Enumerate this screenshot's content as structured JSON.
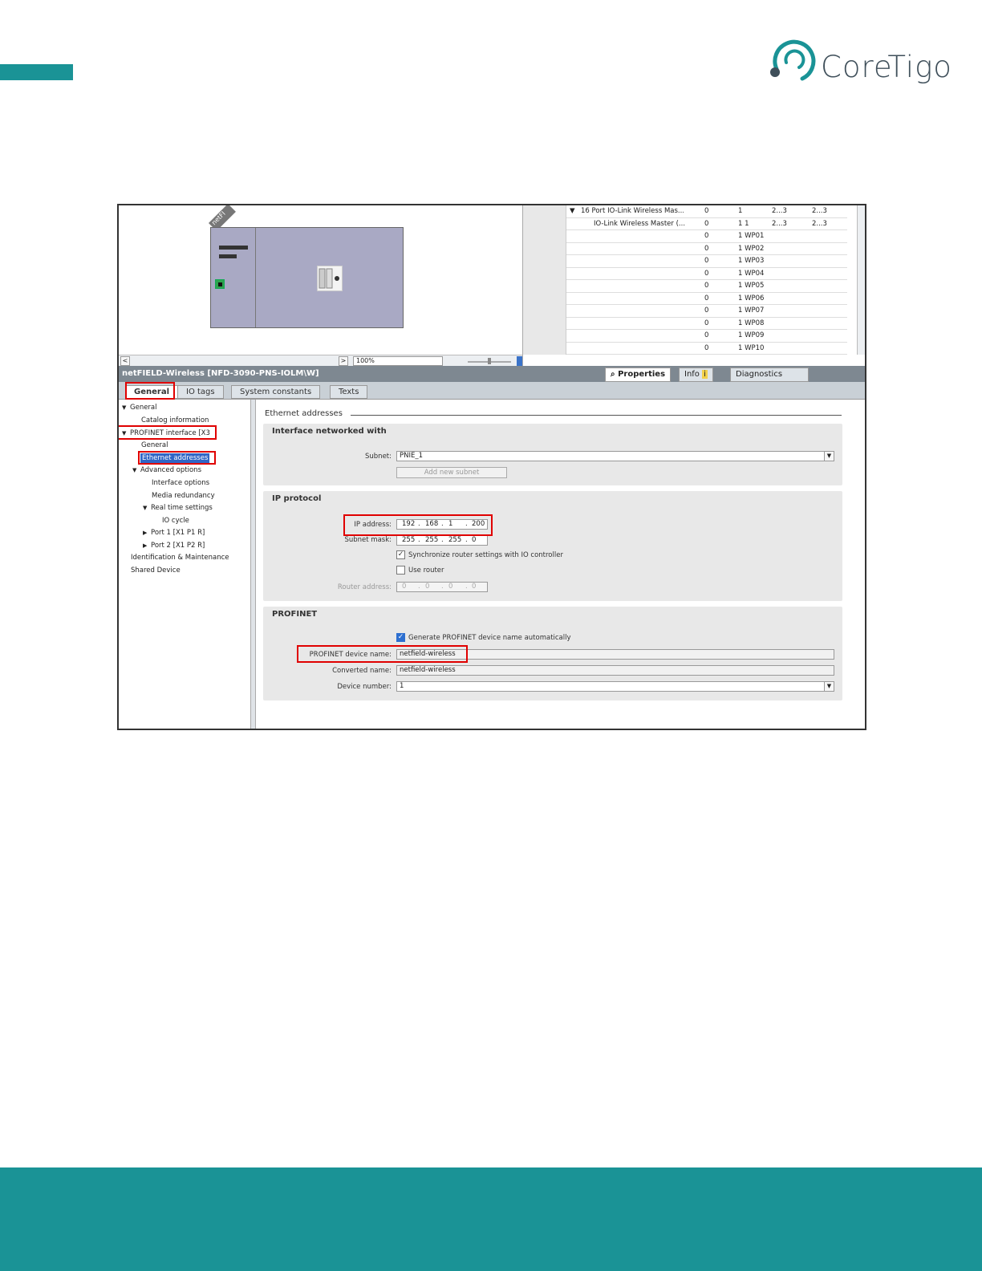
{
  "brand": {
    "logo_text": "CoreTigo"
  },
  "colors": {
    "brand_teal": "#1a9396",
    "highlight_red": "#e00000",
    "selection_blue": "#3166c6"
  },
  "device_view": {
    "tag": "netFI",
    "zoom": "100%"
  },
  "device_table": {
    "rows": [
      {
        "name": "16 Port IO-Link Wireless Mas...",
        "c1": "0",
        "c2": "1",
        "c3": "2...3",
        "c4": "2...3",
        "expand": "▼"
      },
      {
        "name": "IO-Link Wireless Master (...",
        "c1": "0",
        "c2": "1 1",
        "c3": "2...3",
        "c4": "2...3",
        "expand": ""
      },
      {
        "name": "",
        "c1": "0",
        "c2": "1 WP01",
        "c3": "",
        "c4": "",
        "expand": ""
      },
      {
        "name": "",
        "c1": "0",
        "c2": "1 WP02",
        "c3": "",
        "c4": "",
        "expand": ""
      },
      {
        "name": "",
        "c1": "0",
        "c2": "1 WP03",
        "c3": "",
        "c4": "",
        "expand": ""
      },
      {
        "name": "",
        "c1": "0",
        "c2": "1 WP04",
        "c3": "",
        "c4": "",
        "expand": ""
      },
      {
        "name": "",
        "c1": "0",
        "c2": "1 WP05",
        "c3": "",
        "c4": "",
        "expand": ""
      },
      {
        "name": "",
        "c1": "0",
        "c2": "1 WP06",
        "c3": "",
        "c4": "",
        "expand": ""
      },
      {
        "name": "",
        "c1": "0",
        "c2": "1 WP07",
        "c3": "",
        "c4": "",
        "expand": ""
      },
      {
        "name": "",
        "c1": "0",
        "c2": "1 WP08",
        "c3": "",
        "c4": "",
        "expand": ""
      },
      {
        "name": "",
        "c1": "0",
        "c2": "1 WP09",
        "c3": "",
        "c4": "",
        "expand": ""
      },
      {
        "name": "",
        "c1": "0",
        "c2": "1 WP10",
        "c3": "",
        "c4": "",
        "expand": ""
      }
    ]
  },
  "inspector": {
    "title": "netFIELD-Wireless [NFD-3090-PNS-IOLM\\W]",
    "right_tabs": {
      "properties": "Properties",
      "info": "Info",
      "diagnostics": "Diagnostics"
    },
    "tabs": {
      "general": "General",
      "io_tags": "IO tags",
      "system_constants": "System constants",
      "texts": "Texts"
    }
  },
  "nav": {
    "general": "General",
    "catalog_information": "Catalog information",
    "profinet_interface": "PROFINET interface [X3",
    "pn_general": "General",
    "ethernet_addresses": "Ethernet addresses",
    "advanced_options": "Advanced options",
    "interface_options": "Interface options",
    "media_redundancy": "Media redundancy",
    "real_time_settings": "Real time settings",
    "io_cycle": "IO cycle",
    "port1": "Port 1 [X1 P1 R]",
    "port2": "Port 2 [X1 P2 R]",
    "identification": "Identification & Maintenance",
    "shared_device": "Shared Device"
  },
  "content": {
    "section_title": "Ethernet addresses",
    "interface_group": {
      "title": "Interface networked with",
      "subnet_label": "Subnet:",
      "subnet_value": "PNIE_1",
      "add_subnet": "Add new subnet"
    },
    "ip_group": {
      "title": "IP protocol",
      "ip_label": "IP address:",
      "ip": [
        "192",
        "168",
        "1",
        "200"
      ],
      "mask_label": "Subnet mask:",
      "mask": [
        "255",
        "255",
        "255",
        "0"
      ],
      "sync_router_label": "Synchronize router settings with IO controller",
      "use_router_label": "Use router",
      "router_label": "Router address:",
      "router": [
        "0",
        "0",
        "0",
        "0"
      ]
    },
    "profinet_group": {
      "title": "PROFINET",
      "generate_label": "Generate PROFINET device name automatically",
      "device_name_label": "PROFINET device name:",
      "device_name": "netfield-wireless",
      "converted_label": "Converted name:",
      "converted_name": "netfield-wireless",
      "device_number_label": "Device number:",
      "device_number": "1"
    }
  }
}
